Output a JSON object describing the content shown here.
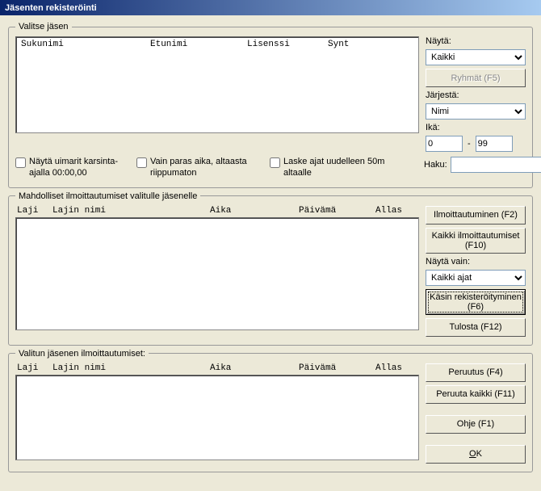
{
  "window": {
    "title": "Jäsenten rekisteröinti"
  },
  "groupbox1": {
    "legend": "Valitse jäsen",
    "headers": {
      "col1": "Sukunimi",
      "col2": "Etunimi",
      "col3": "Lisenssi",
      "col4": "Synt"
    },
    "show_label": "Näytä:",
    "show_value": "Kaikki",
    "btn_groups": "Ryhmät (F5)",
    "sort_label": "Järjestä:",
    "sort_value": "Nimi",
    "age_label": "Ikä:",
    "age_from": "0",
    "age_dash": "-",
    "age_to": "99",
    "chk1": "Näytä uimarit karsinta-ajalla 00:00,00",
    "chk2": "Vain paras aika, altaasta riippumaton",
    "chk3": "Laske ajat uudelleen 50m altaalle",
    "search_label": "Haku:",
    "search_value": ""
  },
  "groupbox2": {
    "legend": "Mahdolliset ilmoittautumiset valitulle jäsenelle",
    "headers": {
      "col1": "Laji",
      "col2": "Lajin nimi",
      "col3": "Aika",
      "col4": "Päivämä",
      "col5": "Allas"
    },
    "btn_register": "Ilmoittautuminen (F2)",
    "btn_register_all": "Kaikki ilmoittautumiset (F10)",
    "only_label": "Näytä vain:",
    "only_value": "Kaikki ajat",
    "btn_manual": "Käsin rekisteröityminen (F6)",
    "btn_print": "Tulosta (F12)"
  },
  "groupbox3": {
    "legend": "Valitun jäsenen ilmoittautumiset:",
    "headers": {
      "col1": "Laji",
      "col2": "Lajin nimi",
      "col3": "Aika",
      "col4": "Päivämä",
      "col5": "Allas"
    },
    "btn_cancel": "Peruutus (F4)",
    "btn_cancel_all": "Peruuta kaikki (F11)",
    "btn_help": "Ohje (F1)",
    "btn_ok_prefix": "O",
    "btn_ok_suffix": "K"
  }
}
